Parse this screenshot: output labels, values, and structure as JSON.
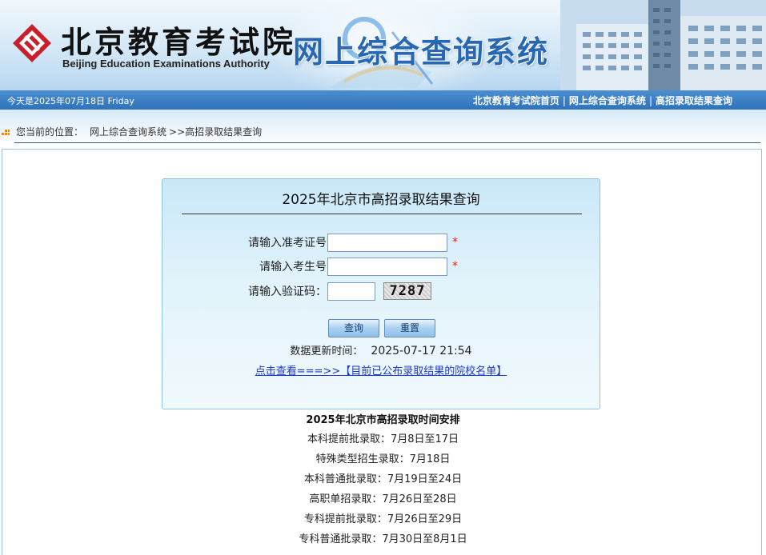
{
  "header": {
    "org_cn": "北京教育考试院",
    "org_en": "Beijing Education Examinations Authority",
    "system_title": "网上综合查询系统"
  },
  "navbar": {
    "date": "今天是2025年07月18日 Friday",
    "links": [
      "北京教育考试院首页",
      "网上综合查询系统",
      "高招录取结果查询"
    ],
    "separator": "|"
  },
  "breadcrumb": {
    "label": "您当前的位置：",
    "home": "网上综合查询系统",
    "current": ">>高招录取结果查询"
  },
  "form": {
    "title": "2025年北京市高招录取结果查询",
    "fields": [
      {
        "label": "请输入准考证号",
        "value": "",
        "required": "*"
      },
      {
        "label": "请输入考生号",
        "value": "",
        "required": "*"
      },
      {
        "label": "请输入验证码：",
        "value": ""
      }
    ],
    "captcha": "7287",
    "submit_label": "查询",
    "reset_label": "重置",
    "update_label": "数据更新时间：",
    "update_time": "2025-07-17 21:54",
    "school_list_link": "点击查看===>>【目前已公布录取结果的院校名单】"
  },
  "schedule": {
    "title": "2025年北京市高招录取时间安排",
    "items": [
      "本科提前批录取：7月8日至17日",
      "特殊类型招生录取：7月18日",
      "本科普通批录取：7月19日至24日",
      "高职单招录取：7月26日至28日",
      "专科提前批录取：7月26日至29日",
      "专科普通批录取：7月30日至8月1日"
    ]
  },
  "colors": {
    "nav_blue": "#3a7dc2",
    "title_blue": "#2867b2",
    "required_red": "#e0261c",
    "link_blue": "#1c39d0"
  }
}
